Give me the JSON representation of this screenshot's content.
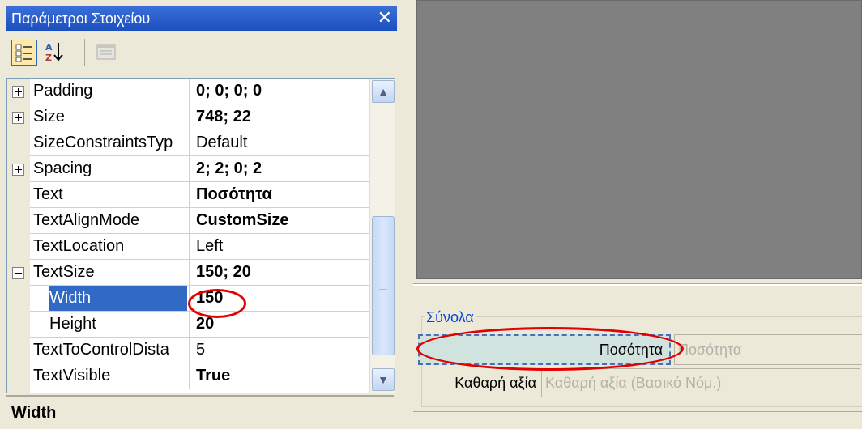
{
  "panel": {
    "title": "Παράμετροι Στοιχείου",
    "close_icon": "close-icon",
    "toolbar": {
      "categorized_icon": "categorized-icon",
      "alphabetical_icon": "sort-az-icon",
      "property_pages_icon": "property-pages-icon"
    },
    "properties": [
      {
        "name": "Padding",
        "value": "0; 0; 0; 0",
        "expander": "plus",
        "bold": true
      },
      {
        "name": "Size",
        "value": "748; 22",
        "expander": "plus",
        "bold": true
      },
      {
        "name": "SizeConstraintsTyp",
        "value": "Default",
        "expander": "none",
        "bold": false
      },
      {
        "name": "Spacing",
        "value": "2; 2; 0; 2",
        "expander": "plus",
        "bold": true
      },
      {
        "name": "Text",
        "value": "Ποσότητα",
        "expander": "none",
        "bold": true
      },
      {
        "name": "TextAlignMode",
        "value": "CustomSize",
        "expander": "none",
        "bold": true
      },
      {
        "name": "TextLocation",
        "value": "Left",
        "expander": "none",
        "bold": false
      },
      {
        "name": "TextSize",
        "value": "150; 20",
        "expander": "minus",
        "bold": true
      },
      {
        "name": "Width",
        "value": "150",
        "expander": "none",
        "bold": true,
        "sub": true,
        "selected": true
      },
      {
        "name": "Height",
        "value": "20",
        "expander": "none",
        "bold": true,
        "sub": true
      },
      {
        "name": "TextToControlDista",
        "value": "5",
        "expander": "none",
        "bold": false
      },
      {
        "name": "TextVisible",
        "value": "True",
        "expander": "none",
        "bold": true
      }
    ],
    "description_title": "Width"
  },
  "designer": {
    "group_title": "Σύνολα",
    "quantity_label": "Ποσότητα",
    "quantity_placeholder": "Ποσότητα",
    "net_label": "Καθαρή αξία",
    "net_placeholder": "Καθαρή αξία (Βασικό Νόμ.)"
  },
  "colors": {
    "selection": "#316ac5",
    "highlight_ellipse": "#e30000",
    "group_title": "#0046d5"
  }
}
